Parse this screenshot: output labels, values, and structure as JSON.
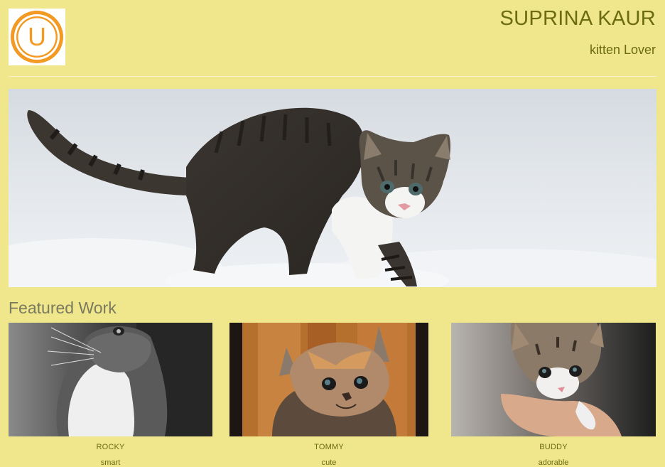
{
  "header": {
    "logo_letter": "U",
    "title": "SUPRINA KAUR",
    "subtitle": "kitten Lover"
  },
  "hero": {
    "image": "kitten-in-snow"
  },
  "featured": {
    "title": "Featured Work",
    "items": [
      {
        "name": "ROCKY",
        "description": "smart",
        "image": "black-and-white-kitten"
      },
      {
        "name": "TOMMY",
        "description": "cute",
        "image": "calico-kitten-wood-background"
      },
      {
        "name": "BUDDY",
        "description": "adorable",
        "image": "tabby-kitten-in-hand"
      }
    ]
  },
  "colors": {
    "background": "#f0e68c",
    "title_text": "#6b6b12",
    "section_title": "#7a7a5e",
    "logo_orange": "#f39a24"
  }
}
